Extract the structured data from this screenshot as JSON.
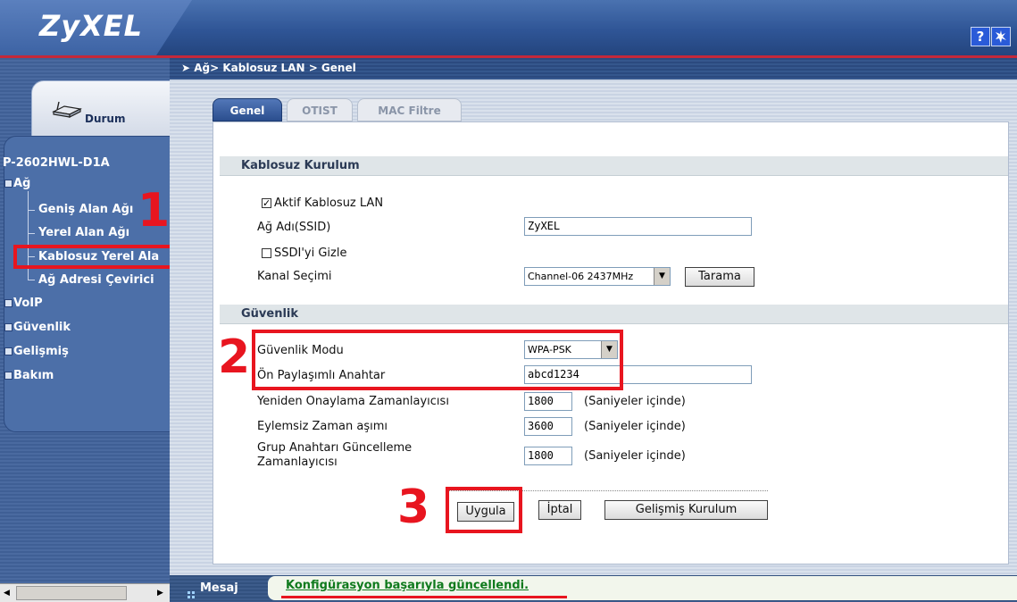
{
  "header": {
    "logo": "ZyXEL",
    "help_icon": "?",
    "wizard_icon": "wizard-icon"
  },
  "breadcrumb": "Ağ> Kablosuz LAN > Genel",
  "sidebar": {
    "status_tab": "Durum",
    "device_name": "P-2602HWL-D1A",
    "menu": [
      {
        "label": "Ağ",
        "expanded": true,
        "children": [
          "Geniş Alan Ağı",
          "Yerel Alan Ağı",
          "Kablosuz Yerel Ala",
          "Ağ Adresi Çevirici"
        ]
      },
      {
        "label": "VoIP"
      },
      {
        "label": "Güvenlik"
      },
      {
        "label": "Gelişmiş"
      },
      {
        "label": "Bakım"
      }
    ],
    "selected": "Kablosuz Yerel Ala"
  },
  "tabs": [
    {
      "label": "Genel",
      "active": true
    },
    {
      "label": "OTIST",
      "active": false
    },
    {
      "label": "MAC Filtre",
      "active": false
    }
  ],
  "wireless_setup": {
    "section_title": "Kablosuz Kurulum",
    "enable_label": "Aktif Kablosuz LAN",
    "enable_checked": true,
    "ssid_label": "Ağ Adı(SSID)",
    "ssid_value": "ZyXEL",
    "hide_ssid_label": "SSDI'yi Gizle",
    "hide_ssid_checked": false,
    "channel_label": "Kanal Seçimi",
    "channel_value": "Channel-06 2437MHz",
    "scan_button": "Tarama"
  },
  "security": {
    "section_title": "Güvenlik",
    "mode_label": "Güvenlik Modu",
    "mode_value": "WPA-PSK",
    "psk_label": "Ön Paylaşımlı Anahtar",
    "psk_value": "abcd1234",
    "reauth_label": "Yeniden Onaylama Zamanlayıcısı",
    "reauth_value": "1800",
    "idle_label": "Eylemsiz Zaman aşımı",
    "idle_value": "3600",
    "groupkey_label_1": "Grup Anahtarı Güncelleme",
    "groupkey_label_2": "Zamanlayıcısı",
    "groupkey_value": "1800",
    "suffix": "(Saniyeler içinde)"
  },
  "buttons": {
    "apply": "Uygula",
    "cancel": "İptal",
    "advanced": "Gelişmiş Kurulum"
  },
  "annotations": {
    "num1": "1",
    "num2": "2",
    "num3": "3"
  },
  "message": {
    "label": "Mesaj",
    "text": "Konfigürasyon başarıyla güncellendi."
  },
  "colors": {
    "accent_red": "#e8151f",
    "header_blue": "#2f5596",
    "success_green": "#0f7a1d"
  }
}
